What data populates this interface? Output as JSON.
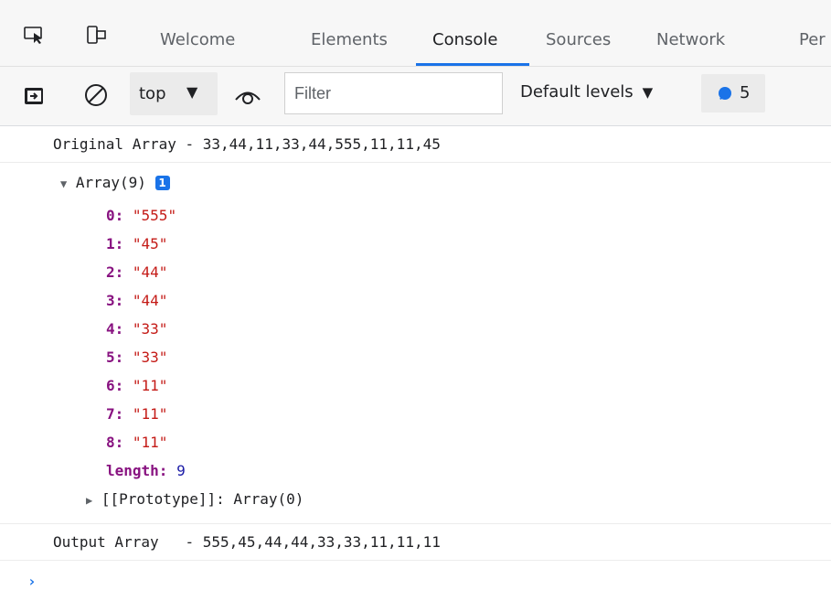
{
  "tabs": [
    {
      "label": "Welcome"
    },
    {
      "label": "Elements"
    },
    {
      "label": "Console"
    },
    {
      "label": "Sources"
    },
    {
      "label": "Network"
    },
    {
      "label": "Per"
    }
  ],
  "active_tab": "Console",
  "toolbar": {
    "context": "top",
    "filter_placeholder": "Filter",
    "levels_label": "Default levels",
    "issues_count": "5"
  },
  "console": {
    "line1": "Original Array - 33,44,11,33,44,555,11,11,45",
    "array_header": "Array(9)",
    "array_badge": "1",
    "items": [
      {
        "key": "0",
        "value": "\"555\""
      },
      {
        "key": "1",
        "value": "\"45\""
      },
      {
        "key": "2",
        "value": "\"44\""
      },
      {
        "key": "3",
        "value": "\"44\""
      },
      {
        "key": "4",
        "value": "\"33\""
      },
      {
        "key": "5",
        "value": "\"33\""
      },
      {
        "key": "6",
        "value": "\"11\""
      },
      {
        "key": "7",
        "value": "\"11\""
      },
      {
        "key": "8",
        "value": "\"11\""
      }
    ],
    "length_key": "length",
    "length_value": "9",
    "prototype": "[[Prototype]]: Array(0)",
    "output_line": "Output Array   - 555,45,44,44,33,33,11,11,11",
    "prompt_symbol": "›"
  },
  "colors": {
    "accent": "#1a73e8",
    "key": "#881280",
    "string": "#c41a16",
    "number": "#1a1aa6"
  }
}
